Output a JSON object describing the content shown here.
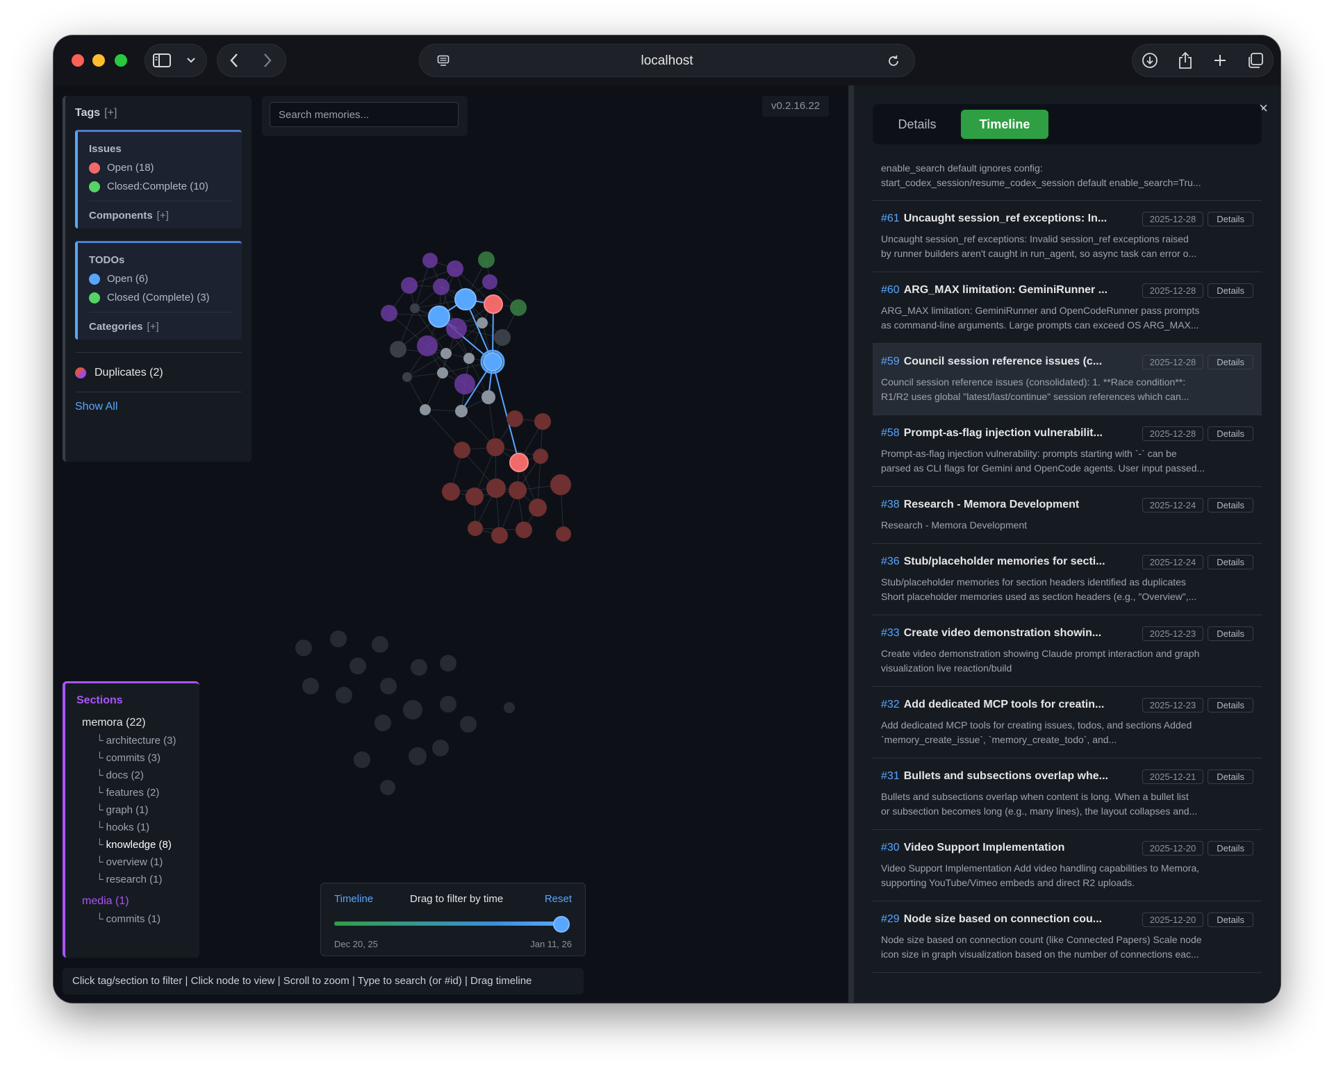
{
  "browser": {
    "address": "localhost"
  },
  "colors": {
    "issue_open": "#f16a6a",
    "issue_closed": "#56d364",
    "todo_open": "#58a6ff",
    "todo_closed": "#56d364",
    "section_accent": "#a855f7",
    "tab_active": "#2ea043",
    "link": "#58a6ff"
  },
  "tags": {
    "title": "Tags",
    "add": "[+]",
    "issues": {
      "label": "Issues",
      "items": [
        {
          "label": "Open (18)",
          "color": "#f16a6a"
        },
        {
          "label": "Closed:Complete (10)",
          "color": "#56d364"
        }
      ],
      "sub_label": "Components",
      "sub_add": "[+]"
    },
    "todos": {
      "label": "TODOs",
      "items": [
        {
          "label": "Open (6)",
          "color": "#58a6ff"
        },
        {
          "label": "Closed (Complete) (3)",
          "color": "#56d364"
        }
      ],
      "sub_label": "Categories",
      "sub_add": "[+]"
    },
    "duplicates": "Duplicates (2)",
    "show_all": "Show All"
  },
  "search": {
    "placeholder": "Search memories..."
  },
  "version": "v0.2.16.22",
  "sections": {
    "title": "Sections",
    "roots": [
      {
        "label": "memora (22)",
        "children": [
          "architecture (3)",
          "commits (3)",
          "docs (2)",
          "features (2)",
          "graph (1)",
          "hooks (1)",
          "knowledge (8)",
          "overview (1)",
          "research (1)"
        ]
      },
      {
        "label": "media (1)",
        "children": [
          "commits (1)"
        ]
      }
    ],
    "branch_glyph": "└"
  },
  "timeline": {
    "title": "Timeline",
    "hint": "Drag to filter by time",
    "reset": "Reset",
    "start_label": "Dec 20, 25",
    "end_label": "Jan 11, 26",
    "position": 1.0
  },
  "help_text": "Click tag/section to filter | Click node to view | Scroll to zoom | Type to search (or #id) | Drag timeline",
  "panel": {
    "tabs": {
      "details": "Details",
      "timeline": "Timeline"
    },
    "active_tab": "Timeline",
    "close_glyph": "×",
    "top_snippet": "enable_search default ignores config:\nstart_codex_session/resume_codex_session default enable_search=Tru...",
    "details_label": "Details",
    "entries": [
      {
        "id": "#61",
        "title": "Uncaught session_ref exceptions: In...",
        "date": "2025-12-28",
        "body": "Uncaught session_ref exceptions: Invalid session_ref exceptions raised\nby runner builders aren't caught in run_agent, so async task can error o..."
      },
      {
        "id": "#60",
        "title": "ARG_MAX limitation: GeminiRunner ...",
        "date": "2025-12-28",
        "body": "ARG_MAX limitation: GeminiRunner and OpenCodeRunner pass prompts\nas command-line arguments. Large prompts can exceed OS ARG_MAX..."
      },
      {
        "id": "#59",
        "title": "Council session reference issues (c...",
        "date": "2025-12-28",
        "body": "Council session reference issues (consolidated): 1. **Race condition**:\nR1/R2 uses global \"latest/last/continue\" session references which can...",
        "highlight": true
      },
      {
        "id": "#58",
        "title": "Prompt-as-flag injection vulnerabilit...",
        "date": "2025-12-28",
        "body": "Prompt-as-flag injection vulnerability: prompts starting with `-` can be\nparsed as CLI flags for Gemini and OpenCode agents. User input passed..."
      },
      {
        "id": "#38",
        "title": "Research - Memora Development",
        "date": "2025-12-24",
        "body": "Research - Memora Development",
        "short": true
      },
      {
        "id": "#36",
        "title": "Stub/placeholder memories for secti...",
        "date": "2025-12-24",
        "body": "Stub/placeholder memories for section headers identified as duplicates\nShort placeholder memories used as section headers (e.g., \"Overview\",..."
      },
      {
        "id": "#33",
        "title": "Create video demonstration showin...",
        "date": "2025-12-23",
        "body": "Create video demonstration showing Claude prompt interaction and graph\nvisualization live reaction/build"
      },
      {
        "id": "#32",
        "title": "Add dedicated MCP tools for creatin...",
        "date": "2025-12-23",
        "body": "Add dedicated MCP tools for creating issues, todos, and sections Added\n`memory_create_issue`, `memory_create_todo`, and..."
      },
      {
        "id": "#31",
        "title": "Bullets and subsections overlap whe...",
        "date": "2025-12-21",
        "body": "Bullets and subsections overlap when content is long. When a bullet list\nor subsection becomes long (e.g., many lines), the layout collapses and..."
      },
      {
        "id": "#30",
        "title": "Video Support Implementation",
        "date": "2025-12-20",
        "body": "Video Support Implementation Add video handling capabilities to Memora,\nsupporting YouTube/Vimeo embeds and direct R2 uploads."
      },
      {
        "id": "#29",
        "title": "Node size based on connection cou...",
        "date": "2025-12-20",
        "body": "Node size based on connection count (like Connected Papers) Scale node\nicon size in graph visualization based on the number of connections eac..."
      }
    ]
  }
}
